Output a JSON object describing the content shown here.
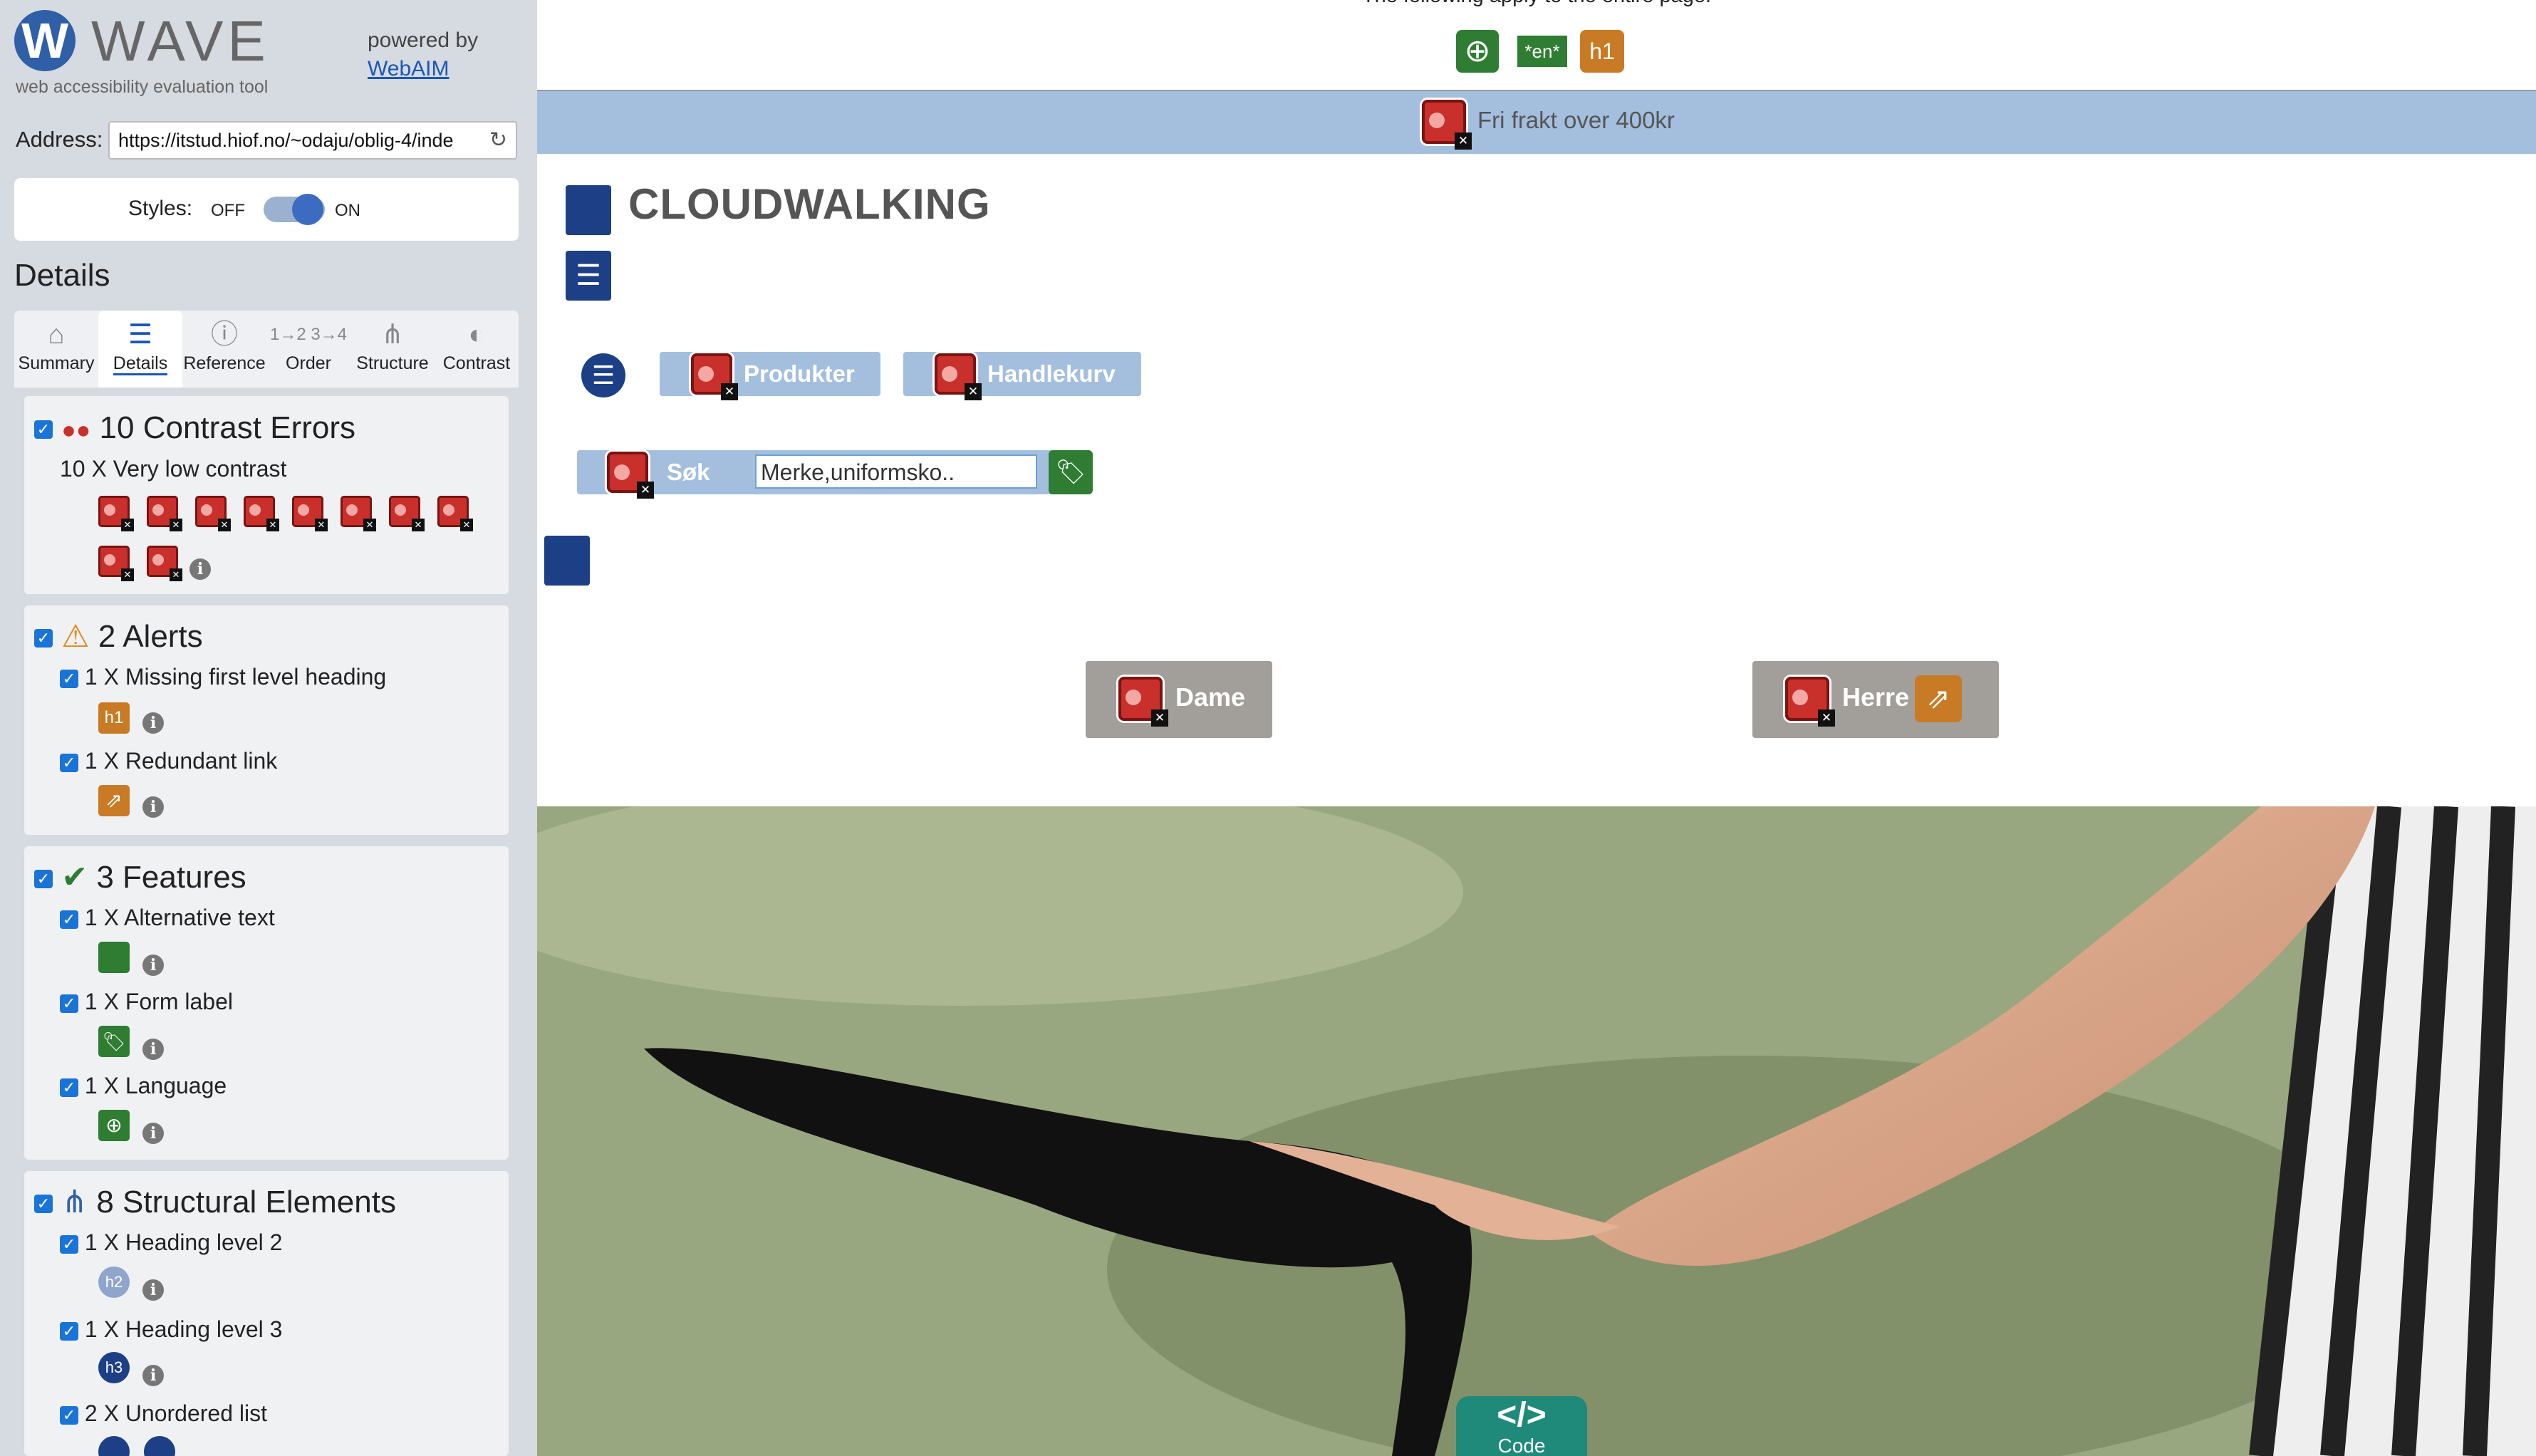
{
  "sidebar": {
    "logo_word": "WAVE",
    "logo_letter": "W",
    "logo_sub": "web accessibility evaluation tool",
    "powered_by": "powered by",
    "webaim_link": "WebAIM",
    "address_label": "Address:",
    "address_value": "https://itstud.hiof.no/~odaju/oblig-4/inde",
    "styles_label": "Styles:",
    "styles_off": "OFF",
    "styles_on": "ON",
    "details_title": "Details",
    "tabs": [
      {
        "label": "Summary",
        "icon": "home-icon"
      },
      {
        "label": "Details",
        "icon": "list-icon"
      },
      {
        "label": "Reference",
        "icon": "info-icon"
      },
      {
        "label": "Order",
        "icon": "order-icon"
      },
      {
        "label": "Structure",
        "icon": "structure-icon"
      },
      {
        "label": "Contrast",
        "icon": "contrast-icon"
      }
    ],
    "errors": {
      "title": "10 Contrast Errors",
      "item": "10 X Very low contrast"
    },
    "alerts": {
      "title": "2 Alerts",
      "items": [
        "1 X Missing first level heading",
        "1 X Redundant link"
      ]
    },
    "features": {
      "title": "3 Features",
      "items": [
        "1 X Alternative text",
        "1 X Form label",
        "1 X Language"
      ]
    },
    "structure": {
      "title": "8 Structural Elements",
      "items": [
        "1 X Heading level 2",
        "1 X Heading level 3",
        "2 X Unordered list"
      ]
    }
  },
  "main": {
    "top_note": "The following apply to the entire page:",
    "lang_badge": "*en*",
    "h1_badge": "h1",
    "banner_text": "Fri frakt over 400kr",
    "site_title": "CLOUDWALKING",
    "nav": [
      "Produkter",
      "Handlekurv"
    ],
    "search_label": "Søk",
    "search_value": "Merke,uniformsko..",
    "categories": [
      "Dame",
      "Herre"
    ],
    "code_label": "Code",
    "code_symbol": "</>"
  },
  "colors": {
    "wave_blue": "#2f5fa6",
    "banner": "#a4bfde",
    "error_red": "#c9302c",
    "category_button": "#a29e99"
  }
}
